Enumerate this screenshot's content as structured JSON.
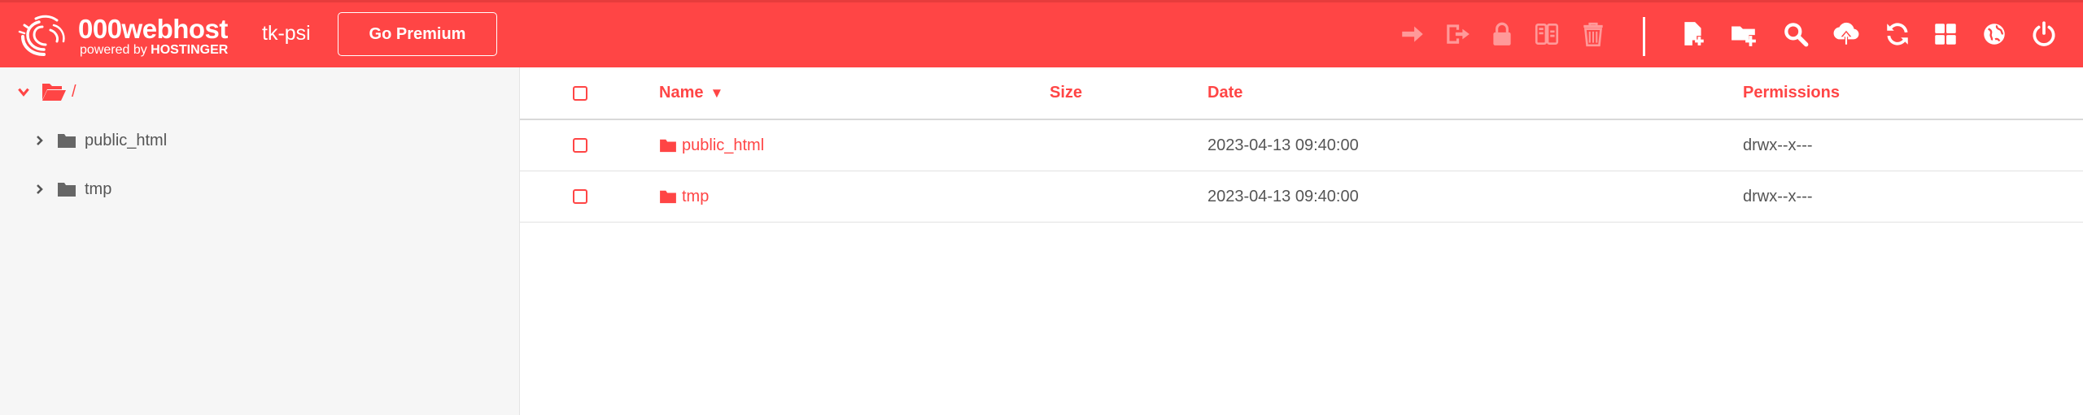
{
  "brand": {
    "name": "000webhost",
    "sub_prefix": "powered by",
    "sub_brand": "HOSTINGER"
  },
  "site_name": "tk-psi",
  "premium_button": "Go Premium",
  "toolbar": {
    "disabled_icons": [
      "move-icon",
      "rename-icon",
      "lock-icon",
      "archive-icon",
      "delete-icon"
    ],
    "enabled_icons": [
      "new-file-icon",
      "new-folder-icon",
      "search-icon",
      "upload-icon",
      "refresh-icon",
      "grid-view-icon",
      "globe-icon",
      "power-icon"
    ]
  },
  "sidebar": {
    "root_label": "/",
    "items": [
      {
        "label": "public_html"
      },
      {
        "label": "tmp"
      }
    ]
  },
  "table": {
    "headers": {
      "name": "Name",
      "sort_indicator": "▼",
      "size": "Size",
      "date": "Date",
      "permissions": "Permissions"
    },
    "rows": [
      {
        "name": "public_html",
        "size": "",
        "date": "2023-04-13 09:40:00",
        "permissions": "drwx--x---"
      },
      {
        "name": "tmp",
        "size": "",
        "date": "2023-04-13 09:40:00",
        "permissions": "drwx--x---"
      }
    ]
  },
  "colors": {
    "accent": "#ff4545",
    "text_muted": "#555555",
    "sidebar_bg": "#f6f6f6"
  }
}
